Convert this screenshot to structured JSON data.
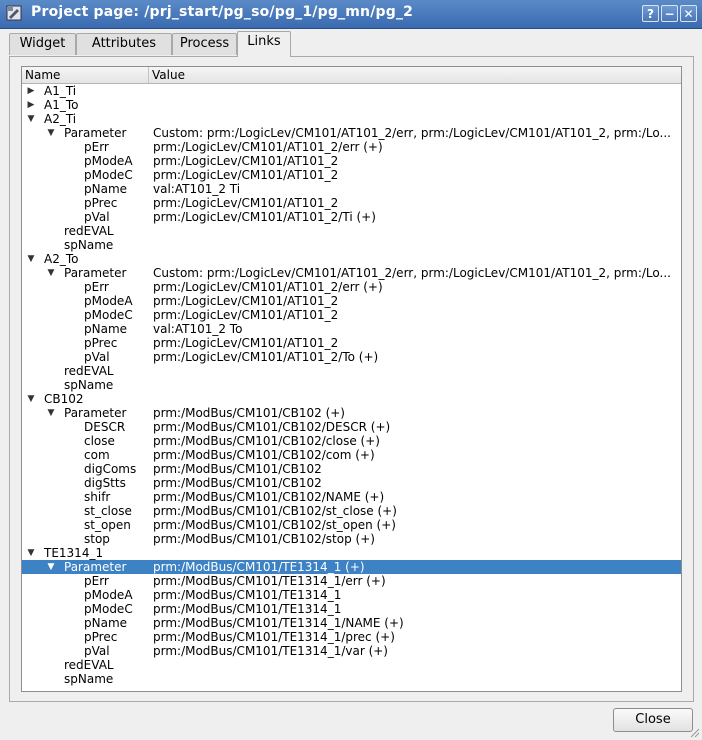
{
  "window": {
    "title": "Project page: /prj_start/pg_so/pg_1/pg_mn/pg_2",
    "help_label": "?",
    "minimize_label": "−",
    "close_label": "✕"
  },
  "tabs": [
    {
      "label": "Widget"
    },
    {
      "label": "Attributes"
    },
    {
      "label": "Process"
    },
    {
      "label": "Links"
    }
  ],
  "tree": {
    "columns": [
      "Name",
      "Value"
    ],
    "rows": [
      {
        "level": 0,
        "expander": "collapsed",
        "name": "A1_Ti",
        "value": ""
      },
      {
        "level": 0,
        "expander": "collapsed",
        "name": "A1_To",
        "value": ""
      },
      {
        "level": 0,
        "expander": "expanded",
        "name": "A2_Ti",
        "value": ""
      },
      {
        "level": 1,
        "expander": "expanded",
        "name": "Parameter",
        "value": "Custom: prm:/LogicLev/CM101/AT101_2/err, prm:/LogicLev/CM101/AT101_2, prm:/Lo..."
      },
      {
        "level": 2,
        "expander": "none",
        "name": "pErr",
        "value": "prm:/LogicLev/CM101/AT101_2/err (+)"
      },
      {
        "level": 2,
        "expander": "none",
        "name": "pModeA",
        "value": "prm:/LogicLev/CM101/AT101_2"
      },
      {
        "level": 2,
        "expander": "none",
        "name": "pModeC",
        "value": "prm:/LogicLev/CM101/AT101_2"
      },
      {
        "level": 2,
        "expander": "none",
        "name": "pName",
        "value": "val:AT101_2 Ti"
      },
      {
        "level": 2,
        "expander": "none",
        "name": "pPrec",
        "value": "prm:/LogicLev/CM101/AT101_2"
      },
      {
        "level": 2,
        "expander": "none",
        "name": "pVal",
        "value": "prm:/LogicLev/CM101/AT101_2/Ti (+)"
      },
      {
        "level": 1,
        "expander": "none",
        "name": "redEVAL",
        "value": ""
      },
      {
        "level": 1,
        "expander": "none",
        "name": "spName",
        "value": ""
      },
      {
        "level": 0,
        "expander": "expanded",
        "name": "A2_To",
        "value": ""
      },
      {
        "level": 1,
        "expander": "expanded",
        "name": "Parameter",
        "value": "Custom: prm:/LogicLev/CM101/AT101_2/err, prm:/LogicLev/CM101/AT101_2, prm:/Lo..."
      },
      {
        "level": 2,
        "expander": "none",
        "name": "pErr",
        "value": "prm:/LogicLev/CM101/AT101_2/err (+)"
      },
      {
        "level": 2,
        "expander": "none",
        "name": "pModeA",
        "value": "prm:/LogicLev/CM101/AT101_2"
      },
      {
        "level": 2,
        "expander": "none",
        "name": "pModeC",
        "value": "prm:/LogicLev/CM101/AT101_2"
      },
      {
        "level": 2,
        "expander": "none",
        "name": "pName",
        "value": "val:AT101_2 To"
      },
      {
        "level": 2,
        "expander": "none",
        "name": "pPrec",
        "value": "prm:/LogicLev/CM101/AT101_2"
      },
      {
        "level": 2,
        "expander": "none",
        "name": "pVal",
        "value": "prm:/LogicLev/CM101/AT101_2/To (+)"
      },
      {
        "level": 1,
        "expander": "none",
        "name": "redEVAL",
        "value": ""
      },
      {
        "level": 1,
        "expander": "none",
        "name": "spName",
        "value": ""
      },
      {
        "level": 0,
        "expander": "expanded",
        "name": "CB102",
        "value": ""
      },
      {
        "level": 1,
        "expander": "expanded",
        "name": "Parameter",
        "value": "prm:/ModBus/CM101/CB102 (+)"
      },
      {
        "level": 2,
        "expander": "none",
        "name": "DESCR",
        "value": "prm:/ModBus/CM101/CB102/DESCR (+)"
      },
      {
        "level": 2,
        "expander": "none",
        "name": "close",
        "value": "prm:/ModBus/CM101/CB102/close (+)"
      },
      {
        "level": 2,
        "expander": "none",
        "name": "com",
        "value": "prm:/ModBus/CM101/CB102/com (+)"
      },
      {
        "level": 2,
        "expander": "none",
        "name": "digComs",
        "value": "prm:/ModBus/CM101/CB102"
      },
      {
        "level": 2,
        "expander": "none",
        "name": "digStts",
        "value": "prm:/ModBus/CM101/CB102"
      },
      {
        "level": 2,
        "expander": "none",
        "name": "shifr",
        "value": "prm:/ModBus/CM101/CB102/NAME (+)"
      },
      {
        "level": 2,
        "expander": "none",
        "name": "st_close",
        "value": "prm:/ModBus/CM101/CB102/st_close (+)"
      },
      {
        "level": 2,
        "expander": "none",
        "name": "st_open",
        "value": "prm:/ModBus/CM101/CB102/st_open (+)"
      },
      {
        "level": 2,
        "expander": "none",
        "name": "stop",
        "value": "prm:/ModBus/CM101/CB102/stop (+)"
      },
      {
        "level": 0,
        "expander": "expanded",
        "name": "TE1314_1",
        "value": ""
      },
      {
        "level": 1,
        "expander": "expanded",
        "name": "Parameter",
        "value": "prm:/ModBus/CM101/TE1314_1 (+)",
        "selected": true
      },
      {
        "level": 2,
        "expander": "none",
        "name": "pErr",
        "value": "prm:/ModBus/CM101/TE1314_1/err (+)"
      },
      {
        "level": 2,
        "expander": "none",
        "name": "pModeA",
        "value": "prm:/ModBus/CM101/TE1314_1"
      },
      {
        "level": 2,
        "expander": "none",
        "name": "pModeC",
        "value": "prm:/ModBus/CM101/TE1314_1"
      },
      {
        "level": 2,
        "expander": "none",
        "name": "pName",
        "value": "prm:/ModBus/CM101/TE1314_1/NAME (+)"
      },
      {
        "level": 2,
        "expander": "none",
        "name": "pPrec",
        "value": "prm:/ModBus/CM101/TE1314_1/prec (+)"
      },
      {
        "level": 2,
        "expander": "none",
        "name": "pVal",
        "value": "prm:/ModBus/CM101/TE1314_1/var (+)"
      },
      {
        "level": 1,
        "expander": "none",
        "name": "redEVAL",
        "value": ""
      },
      {
        "level": 1,
        "expander": "none",
        "name": "spName",
        "value": ""
      }
    ]
  },
  "footer": {
    "close_label": "Close"
  },
  "colors": {
    "titlebar": "#3a6bb0",
    "selection": "#3d82c4"
  }
}
